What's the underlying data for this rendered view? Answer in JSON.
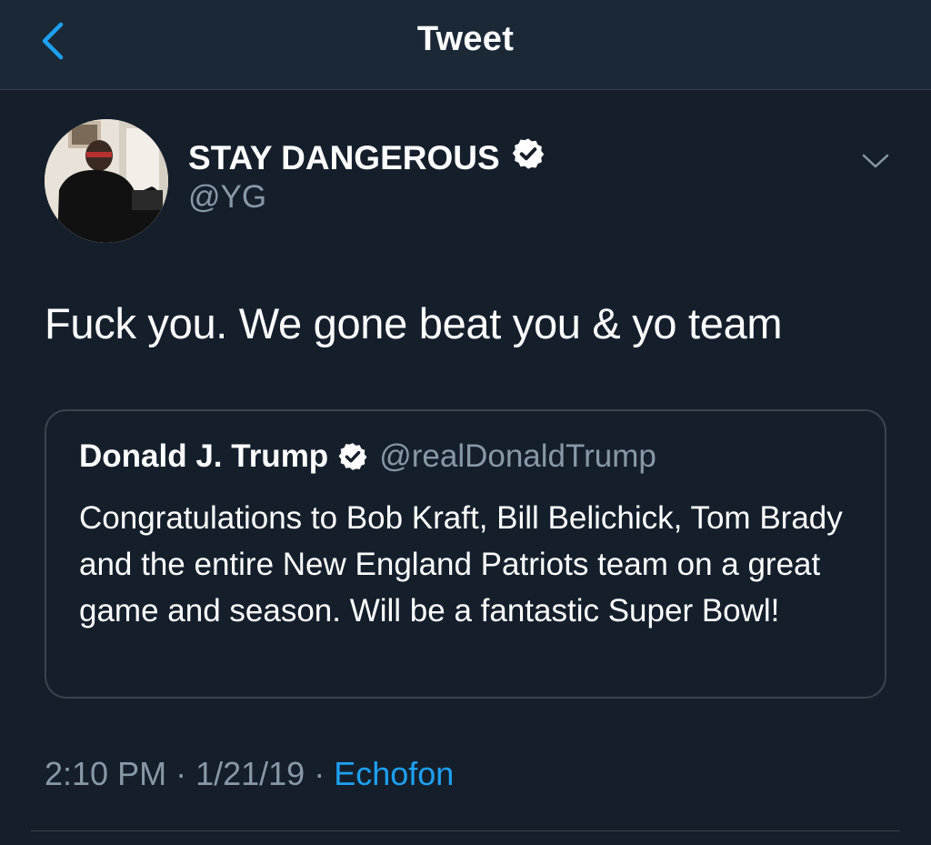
{
  "header": {
    "title": "Tweet",
    "back_icon": "chevron-left-icon"
  },
  "tweet": {
    "author": {
      "name": "STAY DANGEROUS",
      "handle": "@YG",
      "verified": true
    },
    "text": "Fuck you. We gone beat you & yo team",
    "quoted": {
      "name": "Donald J. Trump",
      "handle": "@realDonaldTrump",
      "verified": true,
      "text": "Congratulations to Bob Kraft, Bill Belichick, Tom Brady and the entire New England Patriots team on a great game and season. Will be a fantastic Super Bowl!"
    },
    "meta": {
      "time": "2:10 PM",
      "date": "1/21/19",
      "separator": "·",
      "source": "Echofon"
    }
  },
  "colors": {
    "background": "#151f2b",
    "header_background": "#1b2836",
    "accent": "#1da1f2",
    "secondary_text": "#8899a6",
    "border": "#38444d"
  }
}
